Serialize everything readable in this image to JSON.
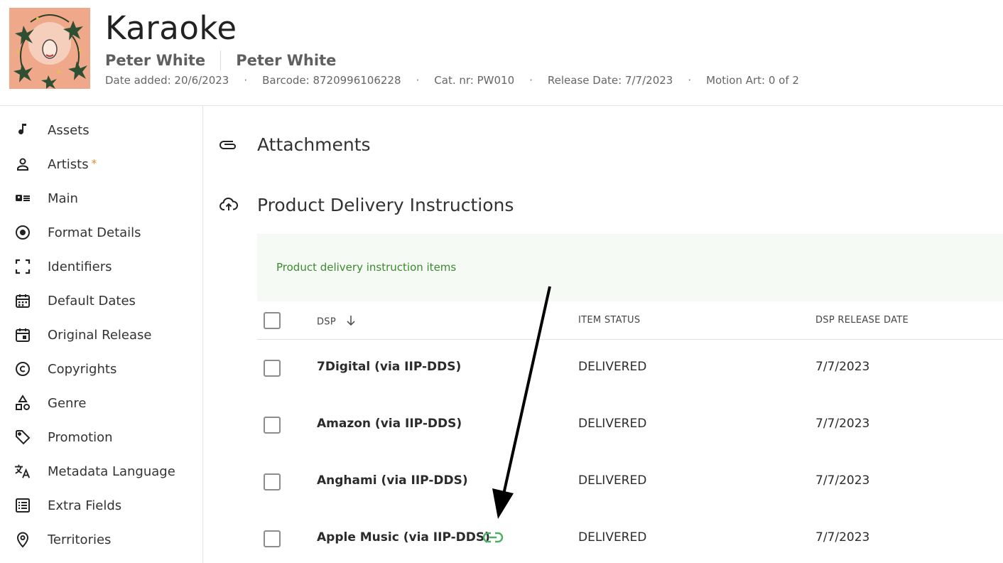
{
  "header": {
    "title": "Karaoke",
    "artists": [
      "Peter White",
      "Peter White"
    ],
    "meta": [
      "Date added: 20/6/2023",
      "Barcode: 8720996106228",
      "Cat. nr: PW010",
      "Release Date: 7/7/2023",
      "Motion Art: 0 of 2"
    ],
    "separator": "·"
  },
  "sidebar": {
    "items": [
      {
        "label": "Assets",
        "icon": "music-note-icon"
      },
      {
        "label": "Artists",
        "icon": "person-icon",
        "required": "*"
      },
      {
        "label": "Main",
        "icon": "id-card-icon"
      },
      {
        "label": "Format Details",
        "icon": "disc-icon"
      },
      {
        "label": "Identifiers",
        "icon": "scan-frame-icon"
      },
      {
        "label": "Default Dates",
        "icon": "calendar-grid-icon"
      },
      {
        "label": "Original Release",
        "icon": "calendar-event-icon"
      },
      {
        "label": "Copyrights",
        "icon": "copyright-icon"
      },
      {
        "label": "Genre",
        "icon": "shapes-icon"
      },
      {
        "label": "Promotion",
        "icon": "tag-icon"
      },
      {
        "label": "Metadata Language",
        "icon": "translate-icon"
      },
      {
        "label": "Extra Fields",
        "icon": "list-box-icon"
      },
      {
        "label": "Territories",
        "icon": "location-pin-icon"
      }
    ]
  },
  "main": {
    "attachments_title": "Attachments",
    "pdi_title": "Product Delivery Instructions",
    "banner_text": "Product delivery instruction items",
    "columns": {
      "dsp": "DSP",
      "status": "ITEM STATUS",
      "date": "DSP RELEASE DATE"
    },
    "rows": [
      {
        "dsp": "7Digital (via IIP-DDS)",
        "status": "DELIVERED",
        "date": "7/7/2023",
        "linked": false
      },
      {
        "dsp": "Amazon (via IIP-DDS)",
        "status": "DELIVERED",
        "date": "7/7/2023",
        "linked": false
      },
      {
        "dsp": "Anghami (via IIP-DDS)",
        "status": "DELIVERED",
        "date": "7/7/2023",
        "linked": false
      },
      {
        "dsp": "Apple Music (via IIP-DDS)",
        "status": "DELIVERED",
        "date": "7/7/2023",
        "linked": true
      }
    ]
  },
  "colors": {
    "accent_green": "#4caf63",
    "banner_bg": "#f5faf4",
    "required_orange": "#e8892b"
  }
}
